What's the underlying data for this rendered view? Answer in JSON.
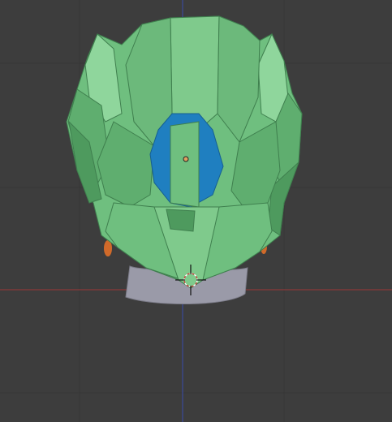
{
  "viewport": {
    "background_color": "#3d3d3d",
    "grid_color": "#363636",
    "x_axis_color": "#8a3a3a",
    "z_axis_color": "#3a4a9a"
  },
  "model": {
    "helmet_color": "#6fbf7f",
    "helmet_dark_color": "#4e9a5e",
    "helmet_light_color": "#8fd69c",
    "visor_color": "#1f7fc0",
    "neck_color": "#9a9aa8",
    "accent_color": "#d06a2a"
  },
  "overlays": {
    "origin_marker_color": "#e0a060",
    "cursor_icon": "3d-cursor-icon"
  }
}
